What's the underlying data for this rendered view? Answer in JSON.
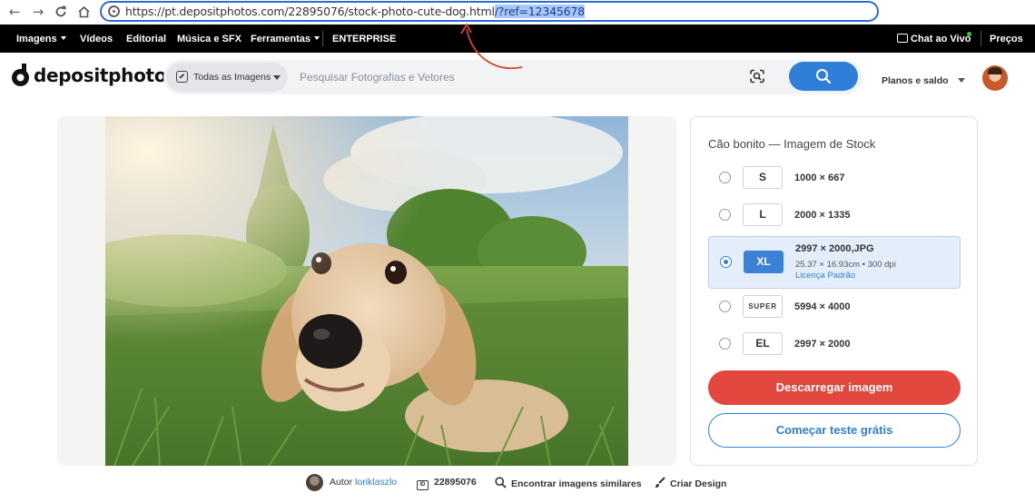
{
  "browser": {
    "url_main": "https://pt.depositphotos.com/22895076/stock-photo-cute-dog.html",
    "url_selected": "/?ref=12345678"
  },
  "topnav": {
    "items": [
      {
        "label": "Imagens",
        "dropdown": true
      },
      {
        "label": "Vídeos",
        "dropdown": false
      },
      {
        "label": "Editorial",
        "dropdown": false
      },
      {
        "label": "Música e SFX",
        "dropdown": false
      },
      {
        "label": "Ferramentas",
        "dropdown": true
      },
      {
        "label": "ENTERPRISE",
        "dropdown": false
      }
    ],
    "chat_label": "Chat ao Vivo",
    "prices_label": "Preços"
  },
  "header": {
    "logo_text": "depositphotos",
    "type_selector_label": "Todas as Imagens",
    "search_placeholder": "Pesquisar Fotografias e Vetores",
    "plans_label": "Planos e saldo"
  },
  "panel": {
    "title": "Cão bonito — Imagem de Stock",
    "options": [
      {
        "size": "S",
        "dims": "1000 × 667",
        "selected": false
      },
      {
        "size": "L",
        "dims": "2000 × 1335",
        "selected": false
      },
      {
        "size": "XL",
        "dims": "2997 × 2000,JPG",
        "meta": "25.37 × 16.93cm • 300 dpi",
        "license": "Licença Padrão",
        "selected": true
      },
      {
        "size": "SUPER",
        "dims": "5994 × 4000",
        "selected": false
      },
      {
        "size": "EL",
        "dims": "2997 × 2000",
        "selected": false
      }
    ],
    "download_label": "Descarregar imagem",
    "trial_label": "Começar teste grátis"
  },
  "footer": {
    "author_prefix": "Autor",
    "author_name": "loriklaszlo",
    "image_id": "22895076",
    "similar_label": "Encontrar imagens similares",
    "design_label": "Criar Design"
  },
  "colors": {
    "accent_blue": "#2f7fd8",
    "download_red": "#e2483d",
    "nav_black": "#000000",
    "annotation_red": "#d9452f"
  }
}
